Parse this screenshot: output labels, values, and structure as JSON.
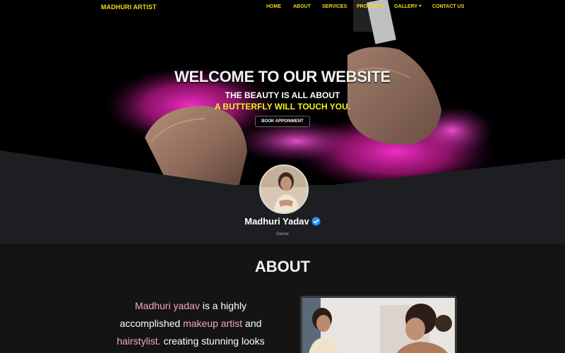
{
  "nav": {
    "brand": "MADHURI ARTIST",
    "links": [
      "HOME",
      "ABOUT",
      "SERVICES",
      "PRODUCTS",
      "GALLERY",
      "CONTACT US"
    ]
  },
  "hero": {
    "title": "WELCOME TO OUR WEBSITE",
    "line1": "THE BEAUTY IS ALL ABOUT",
    "line2": "A BUTTERFLY WILL TOUCH YOU.",
    "button": "BOOK APPOINMENT"
  },
  "profile": {
    "name": "Madhuri Yadav",
    "role": "Owner",
    "verified_icon": "verified-badge-icon"
  },
  "about": {
    "title": "ABOUT",
    "text": {
      "p1": "Madhuri yadav",
      "p2": " is a highly",
      "p3": "accomplished ",
      "p4": "makeup artist",
      "p5": " and",
      "p6": "hairstylist.",
      "p7": " creating stunning looks"
    }
  },
  "colors": {
    "brand_yellow": "#f5d81a",
    "accent_pink": "#f4a6c2",
    "highlight_yellow": "#f5f21a",
    "verified_blue": "#2f8cf0"
  }
}
